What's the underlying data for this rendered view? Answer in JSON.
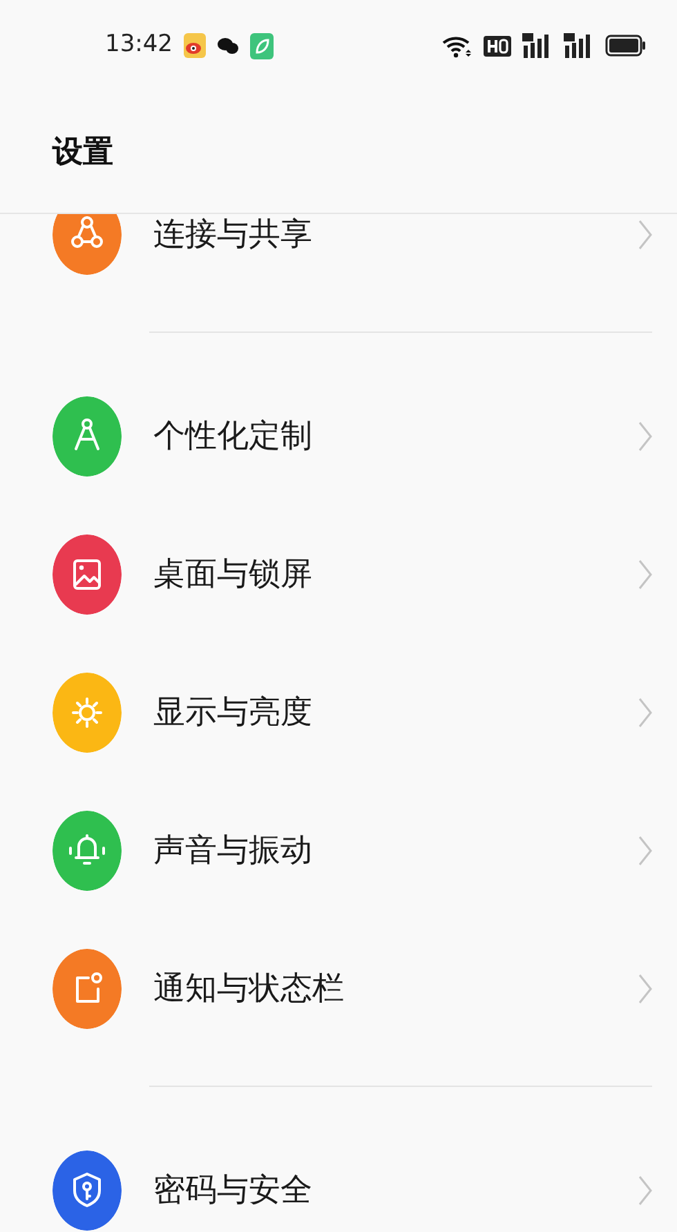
{
  "status_bar": {
    "time": "13:42"
  },
  "header": {
    "title": "设置"
  },
  "groups": [
    {
      "items": [
        {
          "label": "连接与共享",
          "color": "#f47a25"
        }
      ]
    },
    {
      "items": [
        {
          "label": "个性化定制",
          "color": "#2fbf4f"
        },
        {
          "label": "桌面与锁屏",
          "color": "#e83a50"
        },
        {
          "label": "显示与亮度",
          "color": "#fbb714"
        },
        {
          "label": "声音与振动",
          "color": "#2fbf4f"
        },
        {
          "label": "通知与状态栏",
          "color": "#f47a25"
        }
      ]
    },
    {
      "items": [
        {
          "label": "密码与安全",
          "color": "#2b63e6"
        }
      ]
    }
  ]
}
